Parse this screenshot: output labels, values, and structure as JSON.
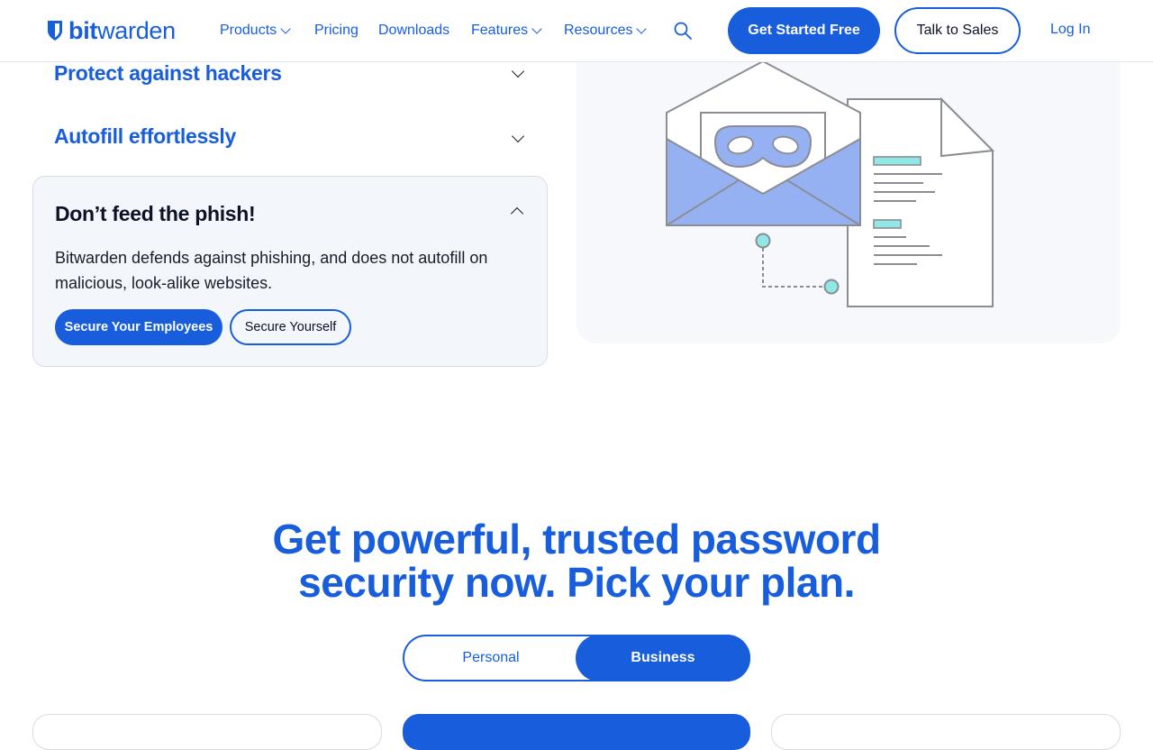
{
  "header": {
    "logo_bold": "bit",
    "logo_light": "warden",
    "nav": [
      {
        "label": "Products",
        "dropdown": true
      },
      {
        "label": "Pricing",
        "dropdown": false
      },
      {
        "label": "Downloads",
        "dropdown": false
      },
      {
        "label": "Features",
        "dropdown": true
      },
      {
        "label": "Resources",
        "dropdown": true
      }
    ],
    "get_started_label": "Get Started Free",
    "talk_sales_label": "Talk to Sales",
    "login_label": "Log In"
  },
  "accordion": {
    "collapsed": [
      {
        "title": "Protect against hackers"
      },
      {
        "title": "Autofill effortlessly"
      }
    ],
    "open": {
      "title": "Don’t feed the phish!",
      "body": "Bitwarden defends against phishing, and does not autofill on malicious, look-alike websites.",
      "primary_button": "Secure Your Employees",
      "secondary_button": "Secure Yourself"
    }
  },
  "plans": {
    "heading_line1": "Get powerful, trusted password",
    "heading_line2": "security now. Pick your plan.",
    "toggle": {
      "personal": "Personal",
      "business": "Business",
      "selected": "Business"
    }
  },
  "colors": {
    "brand": "#175ddc",
    "panel_bg": "#f3f6fb",
    "illustration_fill": "#95b1f2",
    "illustration_accent": "#8fe8e6"
  },
  "icons": [
    "shield-logo-icon",
    "chevron-down-icon",
    "search-icon",
    "chevron-up-icon",
    "phishing-envelope-illustration"
  ]
}
